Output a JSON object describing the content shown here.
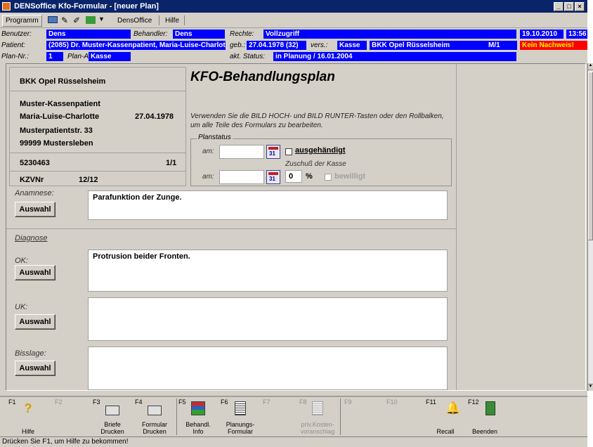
{
  "window": {
    "title": "DENSoffice Kfo-Formular - [neuer Plan]"
  },
  "menu": {
    "programm": "Programm",
    "densoffice": "DensOffice",
    "hilfe": "Hilfe"
  },
  "info": {
    "benutzer_label": "Benutzer:",
    "benutzer": "Dens",
    "behandler_label": "Behandler:",
    "behandler": "Dens",
    "rechte_label": "Rechte:",
    "rechte": "Vollzugriff",
    "date": "19.10.2010",
    "time": "13:56",
    "patient_label": "Patient:",
    "patient": "(2085) Dr. Muster-Kassenpatient, Maria-Luise-Charlotte",
    "geb_label": "geb.:",
    "geb": "27.04.1978 (32)",
    "vers_label": "vers.:",
    "vers": "Kasse",
    "kasse": "BKK Opel Rüsselsheim",
    "mstatus": "M/1",
    "nachweis": "Kein Nachweis!",
    "plannr_label": "Plan-Nr.:",
    "plannr": "1",
    "planart_label": "Plan-Art:",
    "planart": "Kasse",
    "aktstatus_label": "akt. Status:",
    "aktstatus": "in Planung / 16.01.2004"
  },
  "card": {
    "kasse": "BKK Opel Rüsselsheim",
    "name1": "Muster-Kassenpatient",
    "name2": "Maria-Luise-Charlotte",
    "dob": "27.04.1978",
    "street": "Musterpatientstr. 33",
    "city": "99999 Mustersleben",
    "nr": "5230463",
    "nr_right": "1/1",
    "kzv_label": "KZVNr",
    "kzv": "12/12"
  },
  "plan": {
    "title": "KFO-Behandlungsplan",
    "hint": "Verwenden Sie die BILD HOCH- und BILD RUNTER-Tasten oder den Rollbalken, um alle Teile des Formulars zu bearbeiten.",
    "planstatus_label": "Planstatus",
    "am1": "am:",
    "ausgehaendigt": "ausgehändigt",
    "zuschuss": "Zuschuß der Kasse",
    "am2": "am:",
    "percent_value": "0",
    "percent_sign": "%",
    "bewilligt": "bewilligt"
  },
  "anamnese": {
    "label": "Anamnese:",
    "button": "Auswahl",
    "text": "Parafunktion der Zunge."
  },
  "diagnose": {
    "label": "Diagnose"
  },
  "ok": {
    "label": "OK:",
    "button": "Auswahl",
    "text": "Protrusion beider Fronten."
  },
  "uk": {
    "label": "UK:",
    "button": "Auswahl",
    "text": ""
  },
  "bisslage": {
    "label": "Bisslage:",
    "button": "Auswahl",
    "text": ""
  },
  "fkeys": [
    {
      "key": "F1",
      "label": "Hilfe"
    },
    {
      "key": "F2",
      "label": ""
    },
    {
      "key": "F3",
      "label": "Briefe Drucken"
    },
    {
      "key": "F4",
      "label": "Formular Drucken"
    },
    {
      "key": "F5",
      "label": "Behandl. Info"
    },
    {
      "key": "F6",
      "label": "Planungs-Formular"
    },
    {
      "key": "F7",
      "label": ""
    },
    {
      "key": "F8",
      "label": "priv.Kosten-voranschlag"
    },
    {
      "key": "F9",
      "label": ""
    },
    {
      "key": "F10",
      "label": ""
    },
    {
      "key": "F11",
      "label": "Recall"
    },
    {
      "key": "F12",
      "label": "Beenden"
    }
  ],
  "status": "Drücken Sie F1, um Hilfe zu bekommen!"
}
